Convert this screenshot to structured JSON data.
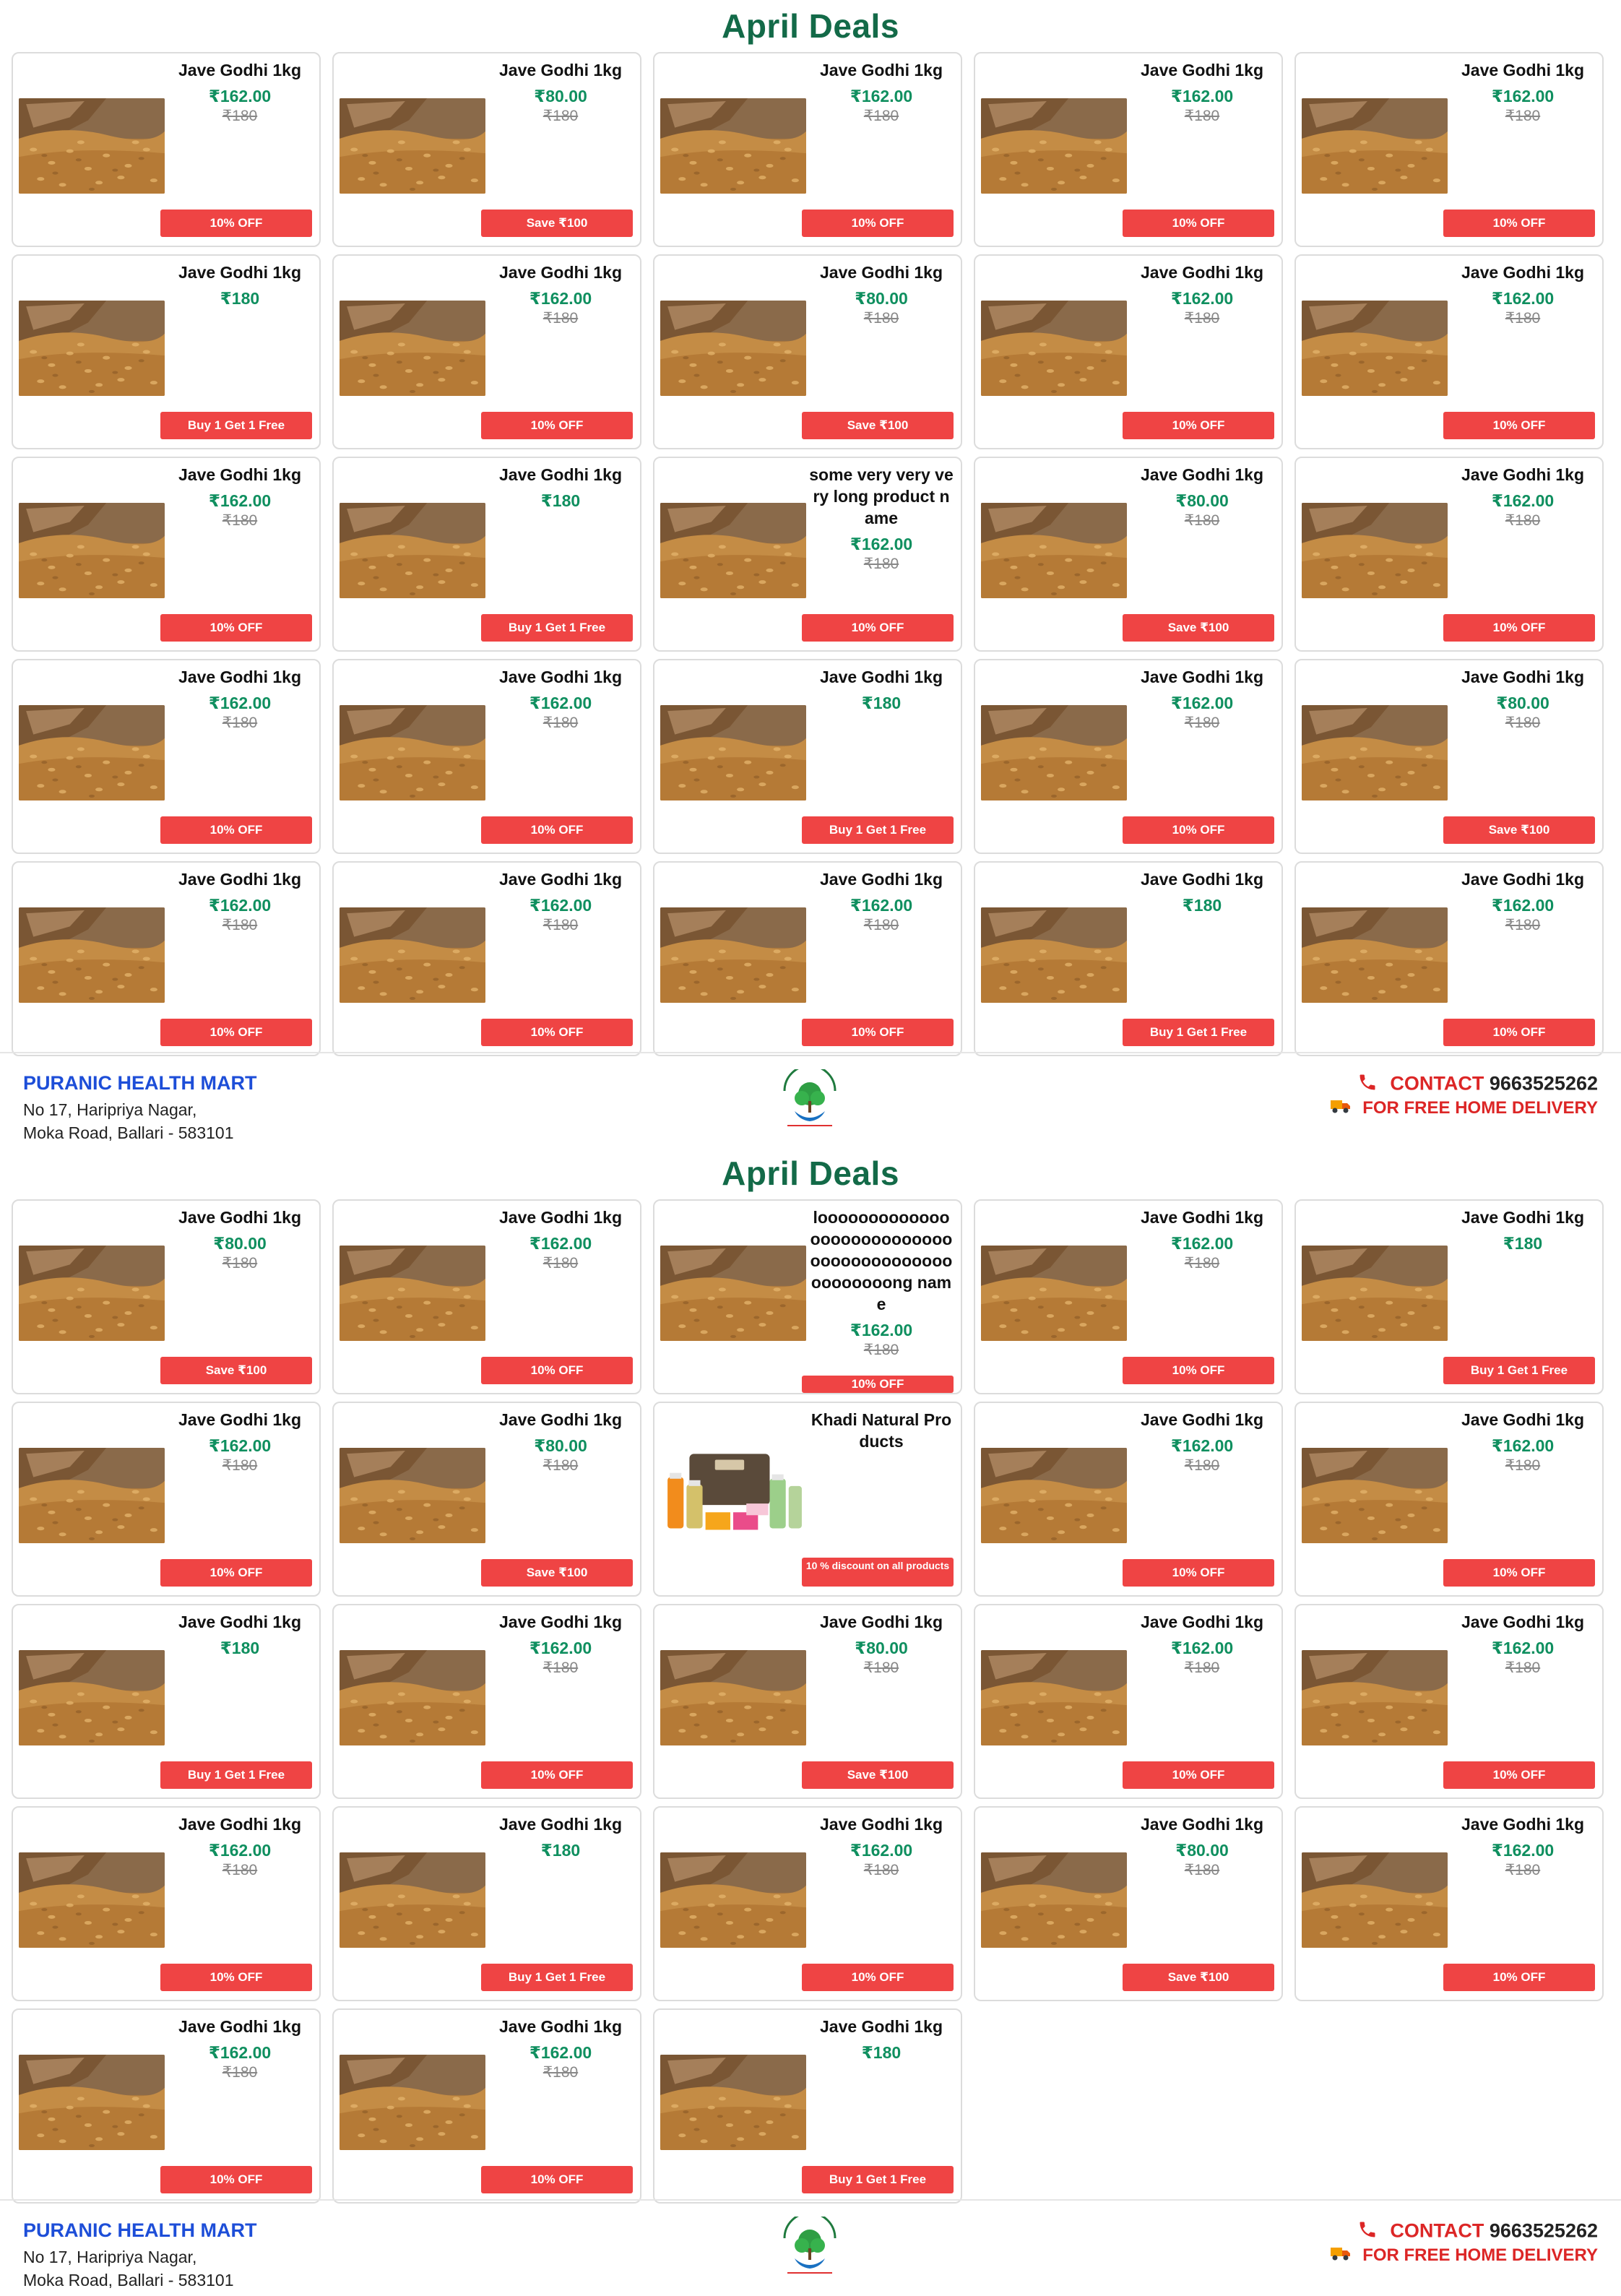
{
  "colors": {
    "title": "#136a48",
    "price": "#0f8f5f",
    "badge": "#ef4444",
    "store": "#1d4ed8",
    "contact": "#dc2626"
  },
  "pages": [
    {
      "title": "April Deals",
      "products": [
        {
          "name": "Jave Godhi 1kg",
          "price": "₹162.00",
          "mrp": "₹180",
          "badge": "10% OFF",
          "image": "wheat-sack"
        },
        {
          "name": "Jave Godhi 1kg",
          "price": "₹80.00",
          "mrp": "₹180",
          "badge": "Save ₹100",
          "image": "wheat-sack"
        },
        {
          "name": "Jave Godhi 1kg",
          "price": "₹162.00",
          "mrp": "₹180",
          "badge": "10% OFF",
          "image": "wheat-sack"
        },
        {
          "name": "Jave Godhi 1kg",
          "price": "₹162.00",
          "mrp": "₹180",
          "badge": "10% OFF",
          "image": "wheat-sack"
        },
        {
          "name": "Jave Godhi 1kg",
          "price": "₹162.00",
          "mrp": "₹180",
          "badge": "10% OFF",
          "image": "wheat-sack"
        },
        {
          "name": "Jave Godhi 1kg",
          "price": "₹180",
          "mrp": "",
          "badge": "Buy 1 Get 1 Free",
          "image": "wheat-sack"
        },
        {
          "name": "Jave Godhi 1kg",
          "price": "₹162.00",
          "mrp": "₹180",
          "badge": "10% OFF",
          "image": "wheat-sack"
        },
        {
          "name": "Jave Godhi 1kg",
          "price": "₹80.00",
          "mrp": "₹180",
          "badge": "Save ₹100",
          "image": "wheat-sack"
        },
        {
          "name": "Jave Godhi 1kg",
          "price": "₹162.00",
          "mrp": "₹180",
          "badge": "10% OFF",
          "image": "wheat-sack"
        },
        {
          "name": "Jave Godhi 1kg",
          "price": "₹162.00",
          "mrp": "₹180",
          "badge": "10% OFF",
          "image": "wheat-sack"
        },
        {
          "name": "Jave Godhi 1kg",
          "price": "₹162.00",
          "mrp": "₹180",
          "badge": "10% OFF",
          "image": "wheat-sack"
        },
        {
          "name": "Jave Godhi 1kg",
          "price": "₹180",
          "mrp": "",
          "badge": "Buy 1 Get 1 Free",
          "image": "wheat-sack"
        },
        {
          "name": "some very very very long product name",
          "price": "₹162.00",
          "mrp": "₹180",
          "badge": "10% OFF",
          "image": "wheat-sack"
        },
        {
          "name": "Jave Godhi 1kg",
          "price": "₹80.00",
          "mrp": "₹180",
          "badge": "Save ₹100",
          "image": "wheat-sack"
        },
        {
          "name": "Jave Godhi 1kg",
          "price": "₹162.00",
          "mrp": "₹180",
          "badge": "10% OFF",
          "image": "wheat-sack"
        },
        {
          "name": "Jave Godhi 1kg",
          "price": "₹162.00",
          "mrp": "₹180",
          "badge": "10% OFF",
          "image": "wheat-sack"
        },
        {
          "name": "Jave Godhi 1kg",
          "price": "₹162.00",
          "mrp": "₹180",
          "badge": "10% OFF",
          "image": "wheat-sack"
        },
        {
          "name": "Jave Godhi 1kg",
          "price": "₹180",
          "mrp": "",
          "badge": "Buy 1 Get 1 Free",
          "image": "wheat-sack"
        },
        {
          "name": "Jave Godhi 1kg",
          "price": "₹162.00",
          "mrp": "₹180",
          "badge": "10% OFF",
          "image": "wheat-sack"
        },
        {
          "name": "Jave Godhi 1kg",
          "price": "₹80.00",
          "mrp": "₹180",
          "badge": "Save ₹100",
          "image": "wheat-sack"
        },
        {
          "name": "Jave Godhi 1kg",
          "price": "₹162.00",
          "mrp": "₹180",
          "badge": "10% OFF",
          "image": "wheat-sack"
        },
        {
          "name": "Jave Godhi 1kg",
          "price": "₹162.00",
          "mrp": "₹180",
          "badge": "10% OFF",
          "image": "wheat-sack"
        },
        {
          "name": "Jave Godhi 1kg",
          "price": "₹162.00",
          "mrp": "₹180",
          "badge": "10% OFF",
          "image": "wheat-sack"
        },
        {
          "name": "Jave Godhi 1kg",
          "price": "₹180",
          "mrp": "",
          "badge": "Buy 1 Get 1 Free",
          "image": "wheat-sack"
        },
        {
          "name": "Jave Godhi 1kg",
          "price": "₹162.00",
          "mrp": "₹180",
          "badge": "10% OFF",
          "image": "wheat-sack"
        }
      ]
    },
    {
      "title": "April Deals",
      "products": [
        {
          "name": "Jave Godhi 1kg",
          "price": "₹80.00",
          "mrp": "₹180",
          "badge": "Save ₹100",
          "image": "wheat-sack"
        },
        {
          "name": "Jave Godhi 1kg",
          "price": "₹162.00",
          "mrp": "₹180",
          "badge": "10% OFF",
          "image": "wheat-sack"
        },
        {
          "name": "looooooooooooooooooooooooooooooooooooooooooooooooong name",
          "price": "₹162.00",
          "mrp": "₹180",
          "badge": "10% OFF",
          "image": "wheat-sack",
          "overflow": true
        },
        {
          "name": "Jave Godhi 1kg",
          "price": "₹162.00",
          "mrp": "₹180",
          "badge": "10% OFF",
          "image": "wheat-sack"
        },
        {
          "name": "Jave Godhi 1kg",
          "price": "₹180",
          "mrp": "",
          "badge": "Buy 1 Get 1 Free",
          "image": "wheat-sack"
        },
        {
          "name": "Jave Godhi 1kg",
          "price": "₹162.00",
          "mrp": "₹180",
          "badge": "10% OFF",
          "image": "wheat-sack"
        },
        {
          "name": "Jave Godhi 1kg",
          "price": "₹80.00",
          "mrp": "₹180",
          "badge": "Save ₹100",
          "image": "wheat-sack"
        },
        {
          "name": "Khadi Natural Products",
          "price": "",
          "mrp": "",
          "badge": "10 % discount on all products",
          "image": "khadi-products",
          "small_badge": true
        },
        {
          "name": "Jave Godhi 1kg",
          "price": "₹162.00",
          "mrp": "₹180",
          "badge": "10% OFF",
          "image": "wheat-sack"
        },
        {
          "name": "Jave Godhi 1kg",
          "price": "₹162.00",
          "mrp": "₹180",
          "badge": "10% OFF",
          "image": "wheat-sack"
        },
        {
          "name": "Jave Godhi 1kg",
          "price": "₹180",
          "mrp": "",
          "badge": "Buy 1 Get 1 Free",
          "image": "wheat-sack"
        },
        {
          "name": "Jave Godhi 1kg",
          "price": "₹162.00",
          "mrp": "₹180",
          "badge": "10% OFF",
          "image": "wheat-sack"
        },
        {
          "name": "Jave Godhi 1kg",
          "price": "₹80.00",
          "mrp": "₹180",
          "badge": "Save ₹100",
          "image": "wheat-sack"
        },
        {
          "name": "Jave Godhi 1kg",
          "price": "₹162.00",
          "mrp": "₹180",
          "badge": "10% OFF",
          "image": "wheat-sack"
        },
        {
          "name": "Jave Godhi 1kg",
          "price": "₹162.00",
          "mrp": "₹180",
          "badge": "10% OFF",
          "image": "wheat-sack"
        },
        {
          "name": "Jave Godhi 1kg",
          "price": "₹162.00",
          "mrp": "₹180",
          "badge": "10% OFF",
          "image": "wheat-sack"
        },
        {
          "name": "Jave Godhi 1kg",
          "price": "₹180",
          "mrp": "",
          "badge": "Buy 1 Get 1 Free",
          "image": "wheat-sack"
        },
        {
          "name": "Jave Godhi 1kg",
          "price": "₹162.00",
          "mrp": "₹180",
          "badge": "10% OFF",
          "image": "wheat-sack"
        },
        {
          "name": "Jave Godhi 1kg",
          "price": "₹80.00",
          "mrp": "₹180",
          "badge": "Save ₹100",
          "image": "wheat-sack"
        },
        {
          "name": "Jave Godhi 1kg",
          "price": "₹162.00",
          "mrp": "₹180",
          "badge": "10% OFF",
          "image": "wheat-sack"
        },
        {
          "name": "Jave Godhi 1kg",
          "price": "₹162.00",
          "mrp": "₹180",
          "badge": "10% OFF",
          "image": "wheat-sack"
        },
        {
          "name": "Jave Godhi 1kg",
          "price": "₹162.00",
          "mrp": "₹180",
          "badge": "10% OFF",
          "image": "wheat-sack"
        },
        {
          "name": "Jave Godhi 1kg",
          "price": "₹180",
          "mrp": "",
          "badge": "Buy 1 Get 1 Free",
          "image": "wheat-sack"
        }
      ]
    }
  ],
  "footer": {
    "store_name": "PURANIC HEALTH MART",
    "address_line1": "No 17, Haripriya Nagar,",
    "address_line2": "Moka Road, Ballari - 583101",
    "contact_label": "CONTACT",
    "phone": "9663525262",
    "delivery": "FOR FREE HOME DELIVERY",
    "phone_icon": "phone-icon",
    "delivery_icon": "truck-icon",
    "logo": "tree-logo"
  }
}
